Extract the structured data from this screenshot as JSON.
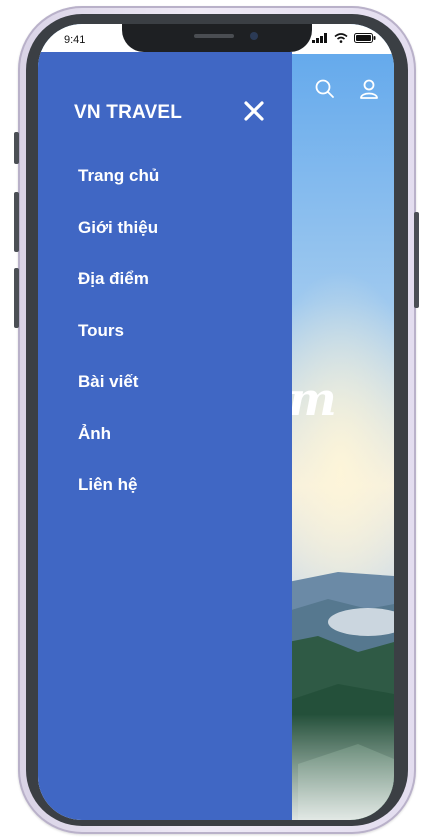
{
  "status_bar": {
    "time": "9:41"
  },
  "drawer": {
    "brand": "VN TRAVEL",
    "menu_items": [
      "Trang chủ",
      "Giới thiệu",
      "Địa điểm",
      "Tours",
      "Bài viết",
      "Ảnh",
      "Liên hệ"
    ]
  },
  "hero": {
    "script_text": "m"
  },
  "icons": {
    "close": "close-icon",
    "search": "search-icon",
    "user": "user-icon",
    "signal": "signal-icon",
    "wifi": "wifi-icon",
    "battery": "battery-icon"
  },
  "colors": {
    "drawer": "#4067c4",
    "text": "#ffffff"
  }
}
